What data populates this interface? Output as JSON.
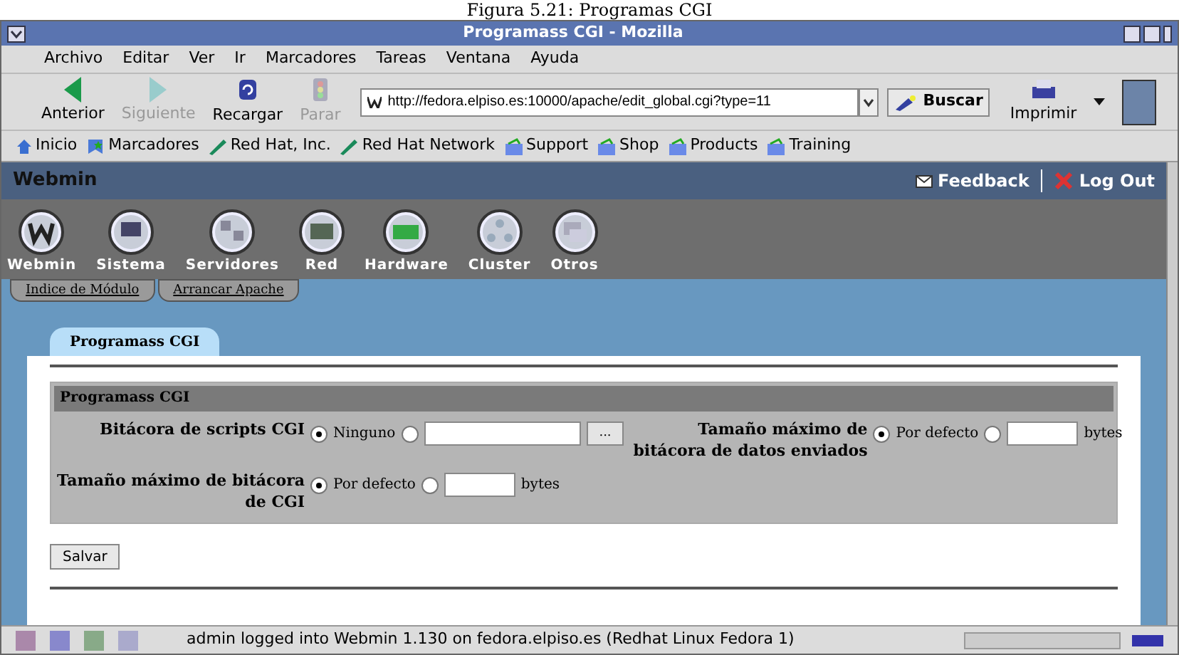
{
  "caption": "Figura 5.21: Programas CGI",
  "window": {
    "title": "Programass CGI - Mozilla"
  },
  "menu": [
    {
      "label": "Archivo"
    },
    {
      "label": "Editar"
    },
    {
      "label": "Ver"
    },
    {
      "label": "Ir"
    },
    {
      "label": "Marcadores"
    },
    {
      "label": "Tareas"
    },
    {
      "label": "Ventana"
    },
    {
      "label": "Ayuda"
    }
  ],
  "nav": [
    {
      "label": "Anterior",
      "kind": "back",
      "disabled": false
    },
    {
      "label": "Siguiente",
      "kind": "forward",
      "disabled": true
    },
    {
      "label": "Recargar",
      "kind": "reload",
      "disabled": false
    },
    {
      "label": "Parar",
      "kind": "stop",
      "disabled": true
    }
  ],
  "url": "http://fedora.elpiso.es:10000/apache/edit_global.cgi?type=11",
  "search_button": "Buscar",
  "print_button": "Imprimir",
  "bookmarks": [
    {
      "label": "Inicio",
      "kind": "home"
    },
    {
      "label": "Marcadores",
      "kind": "bookmarks"
    },
    {
      "label": "Red Hat, Inc.",
      "kind": "link"
    },
    {
      "label": "Red Hat Network",
      "kind": "link"
    },
    {
      "label": "Support",
      "kind": "folder"
    },
    {
      "label": "Shop",
      "kind": "folder"
    },
    {
      "label": "Products",
      "kind": "folder"
    },
    {
      "label": "Training",
      "kind": "folder"
    }
  ],
  "webmin": {
    "brand": "Webmin",
    "feedback": "Feedback",
    "logout": "Log Out",
    "categories": [
      {
        "label": "Webmin"
      },
      {
        "label": "Sistema"
      },
      {
        "label": "Servidores"
      },
      {
        "label": "Red"
      },
      {
        "label": "Hardware"
      },
      {
        "label": "Cluster"
      },
      {
        "label": "Otros"
      }
    ],
    "module_tabs": [
      {
        "label": "Indice de Módulo"
      },
      {
        "label": "Arrancar Apache"
      }
    ],
    "page_tab": "Programass CGI",
    "section": {
      "title": "Programass CGI",
      "fields": [
        {
          "label": "Bitácora de scripts CGI",
          "default_option": {
            "label": "Ninguno",
            "selected": true
          },
          "custom_option": {
            "selected": false,
            "kind": "file",
            "button": "..."
          }
        },
        {
          "label": "Tamaño máximo de bitácora de datos enviados",
          "default_option": {
            "label": "Por defecto",
            "selected": true
          },
          "custom_option": {
            "selected": false,
            "kind": "size",
            "unit": "bytes"
          }
        },
        {
          "label": "Tamaño máximo de bitácora de CGI",
          "default_option": {
            "label": "Por defecto",
            "selected": true
          },
          "custom_option": {
            "selected": false,
            "kind": "size",
            "unit": "bytes"
          }
        }
      ]
    },
    "save_button": "Salvar"
  },
  "status_bar": {
    "level": 0,
    "text": "admin logged into Webmin 1.130 on fedora.elpiso.es (Redhat Linux Fedora 1)"
  }
}
